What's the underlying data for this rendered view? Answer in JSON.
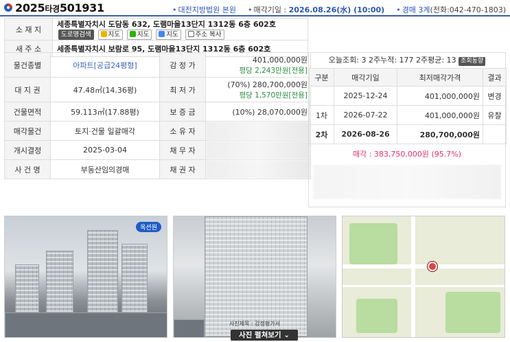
{
  "header": {
    "case_year": "2025",
    "case_kind": "타경",
    "case_no": "501931",
    "court": "대전지방법원 본원",
    "sale_date_label": "매각기일 :",
    "sale_date": "2026.08.26(水) (10:00)",
    "dept": "경매 3계",
    "phone": "(전화:042-470-1803)"
  },
  "address": {
    "location_label": "소 재 지",
    "location": "세종특별자치시 도담동 632, 도램마을13단지 1312동 6층 602호",
    "road_search": "도로명검색",
    "map_daum": "지도",
    "map_naver": "지도",
    "map_google": "지도",
    "copy_addr": "주소 복사",
    "new_label": "새 주 소",
    "new_address": "세종특별자치시 보람로 95, 도램마을13단지 1312동 6층 602호"
  },
  "details": {
    "type_label": "물건종별",
    "type_value": "아파트",
    "type_area": "[공급24평형]",
    "appraisal_label": "감 정 가",
    "appraisal_value": "401,000,000원",
    "appraisal_unit": "평당 2,243만원[전용]",
    "land_label": "대 지 권",
    "land_value": "47.48㎡(14.36평)",
    "min_label": "최 저 가",
    "min_value": "(70%) 280,700,000원",
    "min_unit": "평당 1,570만원[전용]",
    "bldg_label": "건물면적",
    "bldg_value": "59.113㎡(17.88평)",
    "deposit_label": "보 증 금",
    "deposit_value": "(10%) 28,070,000원",
    "sale_obj_label": "매각물건",
    "sale_obj_value": "토지·건물 일괄매각",
    "owner_label": "소 유 자",
    "open_label": "개시결정",
    "open_value": "2025-03-04",
    "debtor_label": "채 무 자",
    "case_label": "사 건 명",
    "case_value": "부동산임의경매",
    "creditor_label": "채 권 자"
  },
  "history": {
    "views": "오늘조회: 3  2주누적: 177  2주평균: 13",
    "views_btn": "조회동향",
    "columns": [
      "구분",
      "매각기일",
      "최저매각가격",
      "결과"
    ],
    "rows": [
      {
        "round": "",
        "date": "2025-12-24",
        "price": "401,000,000원",
        "result": "변경"
      },
      {
        "round": "1차",
        "date": "2026-07-22",
        "price": "401,000,000원",
        "result": "유찰"
      },
      {
        "round": "2차",
        "date": "2026-08-26",
        "price": "280,700,000원",
        "result": ""
      }
    ],
    "sale_result": "매각 : 383,750,000원  (95.7%)"
  },
  "photos": {
    "logo_text": "옥션원",
    "caption": "사진제목 : 감정평가서",
    "unfold": "사진 펼쳐보기"
  }
}
